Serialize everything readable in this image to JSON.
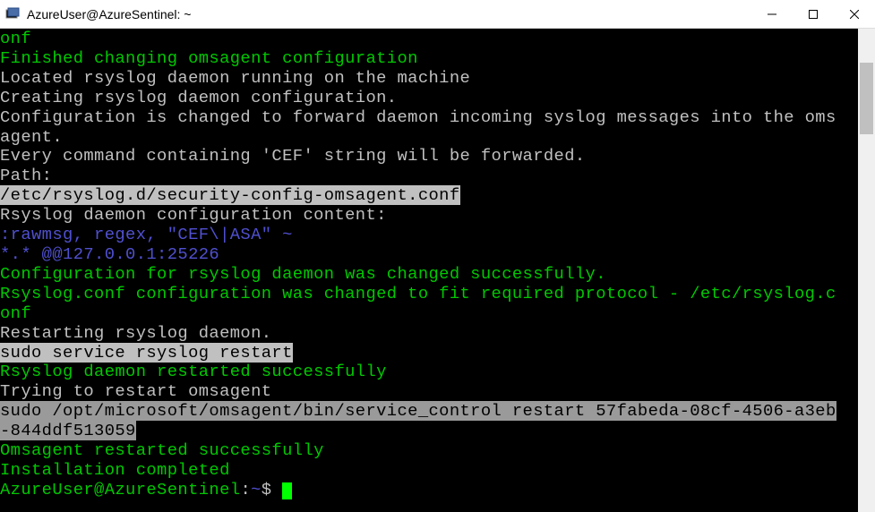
{
  "window": {
    "title": "AzureUser@AzureSentinel: ~"
  },
  "terminal": {
    "lines": [
      {
        "cls": "green",
        "text": "onf"
      },
      {
        "cls": "green",
        "text": "Finished changing omsagent configuration"
      },
      {
        "cls": "gray",
        "text": "Located rsyslog daemon running on the machine"
      },
      {
        "cls": "gray",
        "text": "Creating rsyslog daemon configuration."
      },
      {
        "cls": "gray",
        "text": "Configuration is changed to forward daemon incoming syslog messages into the oms"
      },
      {
        "cls": "gray",
        "text": "agent."
      },
      {
        "cls": "gray",
        "text": "Every command containing 'CEF' string will be forwarded."
      },
      {
        "cls": "gray",
        "text": "Path:"
      },
      {
        "cls": "hl",
        "text": "/etc/rsyslog.d/security-config-omsagent.conf"
      },
      {
        "cls": "gray",
        "text": "Rsyslog daemon configuration content:"
      },
      {
        "cls": "blue",
        "text": ":rawmsg, regex, \"CEF\\|ASA\" ~"
      },
      {
        "cls": "blue",
        "text": "*.* @@127.0.0.1:25226"
      },
      {
        "cls": "green",
        "text": "Configuration for rsyslog daemon was changed successfully."
      },
      {
        "cls": "green",
        "text": "Rsyslog.conf configuration was changed to fit required protocol - /etc/rsyslog.c"
      },
      {
        "cls": "green",
        "text": "onf"
      },
      {
        "cls": "gray",
        "text": "Restarting rsyslog daemon."
      },
      {
        "cls": "hl",
        "text": "sudo service rsyslog restart"
      },
      {
        "cls": "green",
        "text": "Rsyslog daemon restarted successfully"
      },
      {
        "cls": "gray",
        "text": "Trying to restart omsagent"
      },
      {
        "cls": "hl-gray",
        "text": "sudo /opt/microsoft/omsagent/bin/service_control restart 57fabeda-08cf-4506-a3eb"
      },
      {
        "cls": "hl-gray",
        "text": "-844ddf513059"
      },
      {
        "cls": "green",
        "text": "Omsagent restarted successfully"
      },
      {
        "cls": "green",
        "text": "Installation completed"
      }
    ],
    "prompt_user_host": "AzureUser@AzureSentinel",
    "prompt_path": "~",
    "prompt_suffix": "$"
  }
}
